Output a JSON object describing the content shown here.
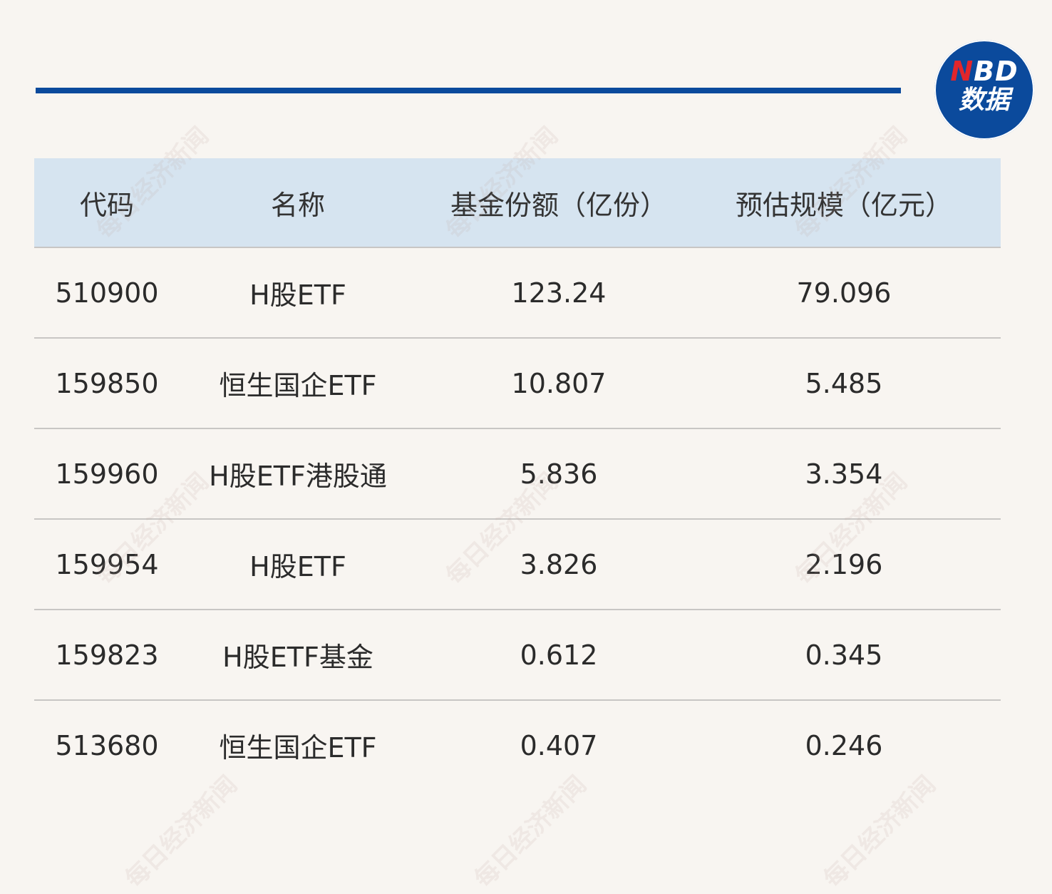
{
  "logo": {
    "nbd_n": "N",
    "nbd_rest": "BD",
    "subtitle": "数据"
  },
  "table": {
    "headers": [
      "代码",
      "名称",
      "基金份额（亿份）",
      "预估规模（亿元）"
    ],
    "rows": [
      [
        "510900",
        "H股ETF",
        "123.24",
        "79.096"
      ],
      [
        "159850",
        "恒生国企ETF",
        "10.807",
        "5.485"
      ],
      [
        "159960",
        "H股ETF港股通",
        "5.836",
        "3.354"
      ],
      [
        "159954",
        "H股ETF",
        "3.826",
        "2.196"
      ],
      [
        "159823",
        "H股ETF基金",
        "0.612",
        "0.345"
      ],
      [
        "513680",
        "恒生国企ETF",
        "0.407",
        "0.246"
      ]
    ]
  },
  "watermark": "每日经济新闻",
  "colors": {
    "accent": "#0b4a9c",
    "header_bg": "#d6e4f0",
    "background": "#f8f5f1",
    "logo_red": "#e2262b"
  }
}
